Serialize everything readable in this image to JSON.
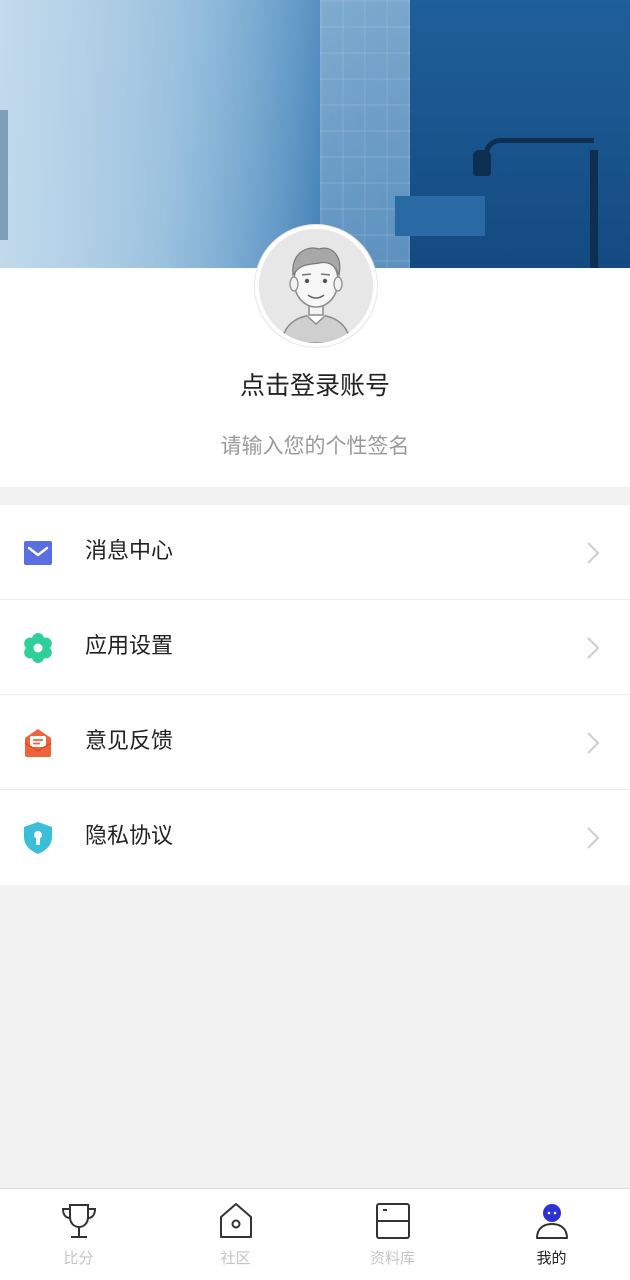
{
  "profile": {
    "login_prompt": "点击登录账号",
    "signature_placeholder": "请输入您的个性签名"
  },
  "menu": {
    "items": [
      {
        "label": "消息中心",
        "icon": "mail-icon",
        "color": "#5b6ee0"
      },
      {
        "label": "应用设置",
        "icon": "gear-icon",
        "color": "#2fcf9a"
      },
      {
        "label": "意见反馈",
        "icon": "feedback-icon",
        "color": "#f0643c"
      },
      {
        "label": "隐私协议",
        "icon": "shield-lock-icon",
        "color": "#3bbfd8"
      }
    ]
  },
  "tabbar": {
    "tabs": [
      {
        "label": "比分",
        "icon": "trophy-icon",
        "active": false
      },
      {
        "label": "社区",
        "icon": "home-icon",
        "active": false
      },
      {
        "label": "资料库",
        "icon": "database-icon",
        "active": false
      },
      {
        "label": "我的",
        "icon": "user-icon",
        "active": true
      }
    ]
  },
  "colors": {
    "active_tab_icon": "#2f2fd6",
    "inactive_tab_label": "#c4c4c4",
    "page_background": "#f2f2f2"
  }
}
